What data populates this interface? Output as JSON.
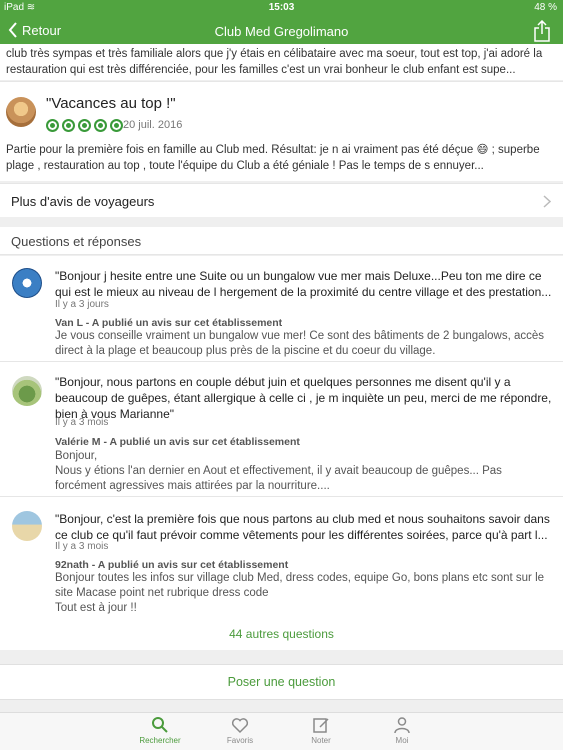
{
  "status_bar": {
    "left": "iPad ≋",
    "time": "15:03",
    "battery": "48 %"
  },
  "nav": {
    "back_label": "Retour",
    "title": "Club Med Gregolimano"
  },
  "previous_review_excerpt": "club très sympas et très familiale alors que j'y étais en célibataire avec ma soeur, tout est top, j'ai adoré la restauration qui est très différenciée, pour les familles c'est un vrai bonheur le club enfant est supe...",
  "review": {
    "title": "\"Vacances au top !\"",
    "rating": 5,
    "date": "20 juil. 2016",
    "text": "Partie pour la première fois en famille au Club med. Résultat: je n ai vraiment pas été déçue 😄 ; superbe plage , restauration au top ,  toute l'équipe du Club a été géniale ! Pas le temps de s ennuyer..."
  },
  "more_reviews_label": "Plus d'avis de voyageurs",
  "qa": {
    "header": "Questions et réponses",
    "items": [
      {
        "question": "\"Bonjour j hesite entre une Suite ou un bungalow vue mer mais Deluxe...Peu ton me dire ce qui est le mieux au niveau de l hergement de la proximité du centre village et des prestation...",
        "time": "Il y a 3 jours",
        "author": "Van L - A publié un avis sur cet établissement",
        "answer": "Je vous conseille vraiment un bungalow vue mer! Ce sont des bâtiments de 2 bungalows, accès direct à la plage et beaucoup plus près de la piscine et du coeur du village."
      },
      {
        "question": "\"Bonjour, nous partons en couple début juin et quelques personnes me disent qu'il y a beaucoup de guêpes, étant allergique à celle ci , je m inquiète un peu, merci de me répondre, bien à vous Marianne\"",
        "time": "Il y a 3 mois",
        "author": "Valérie M - A publié un avis sur cet établissement",
        "answer": "Bonjour,\nNous y étions l'an dernier en Aout et effectivement, il y avait beaucoup de guêpes... Pas forcément agressives mais attirées par la nourriture...."
      },
      {
        "question": "\"Bonjour, c'est la première fois que nous partons au club med et nous souhaitons savoir dans ce club ce qu'il faut prévoir comme vêtements pour les différentes soirées, parce qu'à part l...",
        "time": "Il y a 3 mois",
        "author": "92nath - A publié un avis sur cet établissement",
        "answer": "Bonjour toutes les infos sur village club Med, dress codes, equipe Go, bons plans etc sont sur le site Macase point net rubrique dress code\nTout est à jour !!"
      }
    ],
    "more_questions": "44 autres questions",
    "ask_button": "Poser une question"
  },
  "tabs": [
    {
      "label": "Rechercher",
      "icon": "search-icon",
      "active": true
    },
    {
      "label": "Favoris",
      "icon": "heart-icon",
      "active": false
    },
    {
      "label": "Noter",
      "icon": "edit-icon",
      "active": false
    },
    {
      "label": "Moi",
      "icon": "person-icon",
      "active": false
    }
  ],
  "colors": {
    "brand_green": "#51a440",
    "link_green": "#4b9b3c",
    "bubble_green": "#3a9a3a"
  }
}
